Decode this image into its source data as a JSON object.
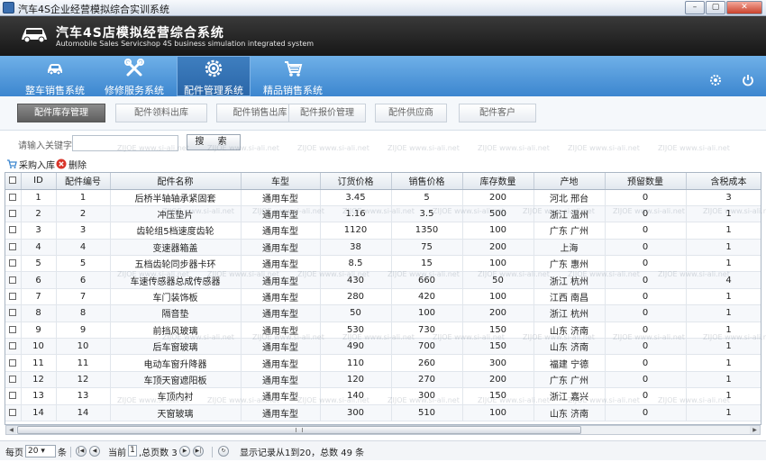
{
  "window": {
    "title": "汽车4S企业经营模拟综合实训系统",
    "buttons": [
      "–",
      "▢",
      "✕"
    ]
  },
  "header": {
    "title_cn": "汽车4S店模拟经营综合系统",
    "title_en": "Automobile Sales Servicshop 4S business simulation integrated system"
  },
  "nav": {
    "items": [
      {
        "label": "整车销售系统",
        "icon": "car-icon"
      },
      {
        "label": "修修服务系统",
        "icon": "tools-icon"
      },
      {
        "label": "配件管理系统",
        "icon": "gear-icon"
      },
      {
        "label": "精品销售系统",
        "icon": "cart-icon"
      }
    ],
    "active": 2
  },
  "subtabs": {
    "items": [
      "配件库存管理",
      "配件领料出库",
      "配件销售出库",
      "配件报价管理",
      "配件供应商",
      "配件客户"
    ],
    "active": 0
  },
  "search": {
    "label": "请输入关键字：",
    "value": "",
    "button": "搜 索"
  },
  "toolbar": {
    "purchase": "采购入库",
    "delete": "删除"
  },
  "table": {
    "columns": [
      "",
      "ID",
      "配件编号",
      "配件名称",
      "车型",
      "订货价格",
      "销售价格",
      "库存数量",
      "产地",
      "预留数量",
      "含税成本"
    ],
    "rows": [
      [
        "1",
        "1",
        "后桥半轴轴承紧固套",
        "通用车型",
        "3.45",
        "5",
        "200",
        "河北 邢台",
        "0",
        "3"
      ],
      [
        "2",
        "2",
        "冲压垫片",
        "通用车型",
        "1.16",
        "3.5",
        "500",
        "浙江 温州",
        "0",
        "1"
      ],
      [
        "3",
        "3",
        "齿轮组5档速度齿轮",
        "通用车型",
        "1120",
        "1350",
        "100",
        "广东 广州",
        "0",
        "1"
      ],
      [
        "4",
        "4",
        "变速器箱盖",
        "通用车型",
        "38",
        "75",
        "200",
        "上海",
        "0",
        "1"
      ],
      [
        "5",
        "5",
        "五档齿轮同步器卡环",
        "通用车型",
        "8.5",
        "15",
        "100",
        "广东 惠州",
        "0",
        "1"
      ],
      [
        "6",
        "6",
        "车速传感器总成传感器",
        "通用车型",
        "430",
        "660",
        "50",
        "浙江 杭州",
        "0",
        "4"
      ],
      [
        "7",
        "7",
        "车门装饰板",
        "通用车型",
        "280",
        "420",
        "100",
        "江西 南昌",
        "0",
        "1"
      ],
      [
        "8",
        "8",
        "隔音垫",
        "通用车型",
        "50",
        "100",
        "200",
        "浙江 杭州",
        "0",
        "1"
      ],
      [
        "9",
        "9",
        "前挡风玻璃",
        "通用车型",
        "530",
        "730",
        "150",
        "山东 济南",
        "0",
        "1"
      ],
      [
        "10",
        "10",
        "后车窗玻璃",
        "通用车型",
        "490",
        "700",
        "150",
        "山东 济南",
        "0",
        "1"
      ],
      [
        "11",
        "11",
        "电动车窗升降器",
        "通用车型",
        "110",
        "260",
        "300",
        "福建 宁德",
        "0",
        "1"
      ],
      [
        "12",
        "12",
        "车顶天窗遮阳板",
        "通用车型",
        "120",
        "270",
        "200",
        "广东 广州",
        "0",
        "1"
      ],
      [
        "13",
        "13",
        "车顶内衬",
        "通用车型",
        "140",
        "300",
        "150",
        "浙江 嘉兴",
        "0",
        "1"
      ],
      [
        "14",
        "14",
        "天窗玻璃",
        "通用车型",
        "300",
        "510",
        "100",
        "山东 济南",
        "0",
        "1"
      ]
    ]
  },
  "pager": {
    "per_page_label": "每页",
    "per_page": "20",
    "unit": "条",
    "current_label": "当前",
    "current": "1",
    "total_pages": ",总页数 3",
    "summary": "显示记录从1到20，总数 49 条"
  },
  "watermark": "ZIJOE  www.si-ali.net",
  "colors": {
    "nav": "#3c86cf",
    "header": "#1e1e1e",
    "active_subtab": "#6a6a6a"
  }
}
